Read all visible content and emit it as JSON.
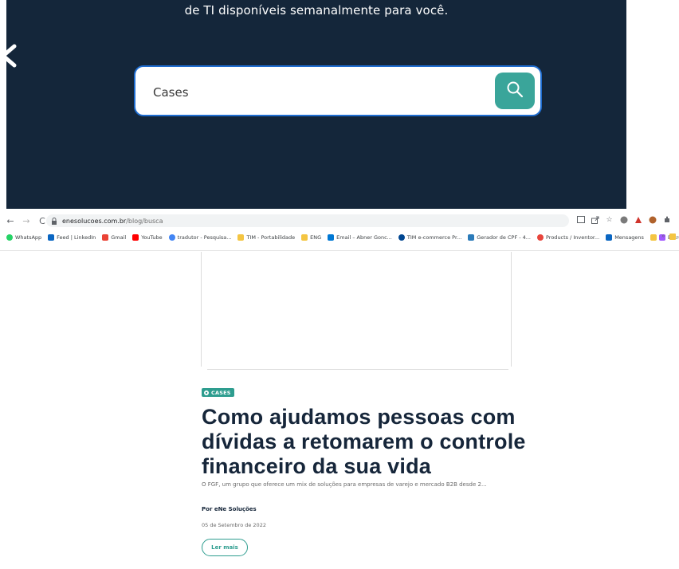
{
  "hero": {
    "subtitle": "de TI disponíveis semanalmente para você.",
    "back_icon": "chevron-left-icon",
    "search": {
      "value": "Cases",
      "button_icon": "search-icon",
      "accent_color": "#3aa59a",
      "border_color": "#1f6dd0"
    },
    "background_color": "#14263a"
  },
  "browser": {
    "url_domain": "enesolucoes.com.br",
    "url_path": "/blog/busca",
    "bookmarks": [
      {
        "label": "WhatsApp",
        "color": "#25d366"
      },
      {
        "label": "Feed | LinkedIn",
        "color": "#0a66c2"
      },
      {
        "label": "Gmail",
        "color": "#ea4335"
      },
      {
        "label": "YouTube",
        "color": "#ff0000"
      },
      {
        "label": "tradutor - Pesquisa...",
        "color": "#4285f4"
      },
      {
        "label": "TIM - Portabilidade",
        "color": "#f4c542"
      },
      {
        "label": "ENG",
        "color": "#f4c542"
      },
      {
        "label": "Email – Abner Gonc...",
        "color": "#0078d4"
      },
      {
        "label": "TIM e-commerce Pr...",
        "color": "#004691"
      },
      {
        "label": "Gerador de CPF - 4...",
        "color": "#2b7bb9"
      },
      {
        "label": "Products / Inventor...",
        "color": "#e8453c"
      },
      {
        "label": "Mensagens",
        "color": "#0a66c2"
      },
      {
        "label": "Entrega-final-DS-ca...",
        "color": "#a259ff"
      }
    ],
    "more_label": "»"
  },
  "article": {
    "category": "CASES",
    "title": "Como ajudamos pessoas com dívidas a retomarem o controle financeiro da sua vida",
    "excerpt": "O FGF, um grupo que oferece um mix de soluções para empresas de varejo e mercado B2B desde 2...",
    "author": "Por eNe Soluções",
    "date": "05 de Setembro de 2022",
    "read_more": "Ler mais",
    "accent_color": "#2e9d8f"
  }
}
